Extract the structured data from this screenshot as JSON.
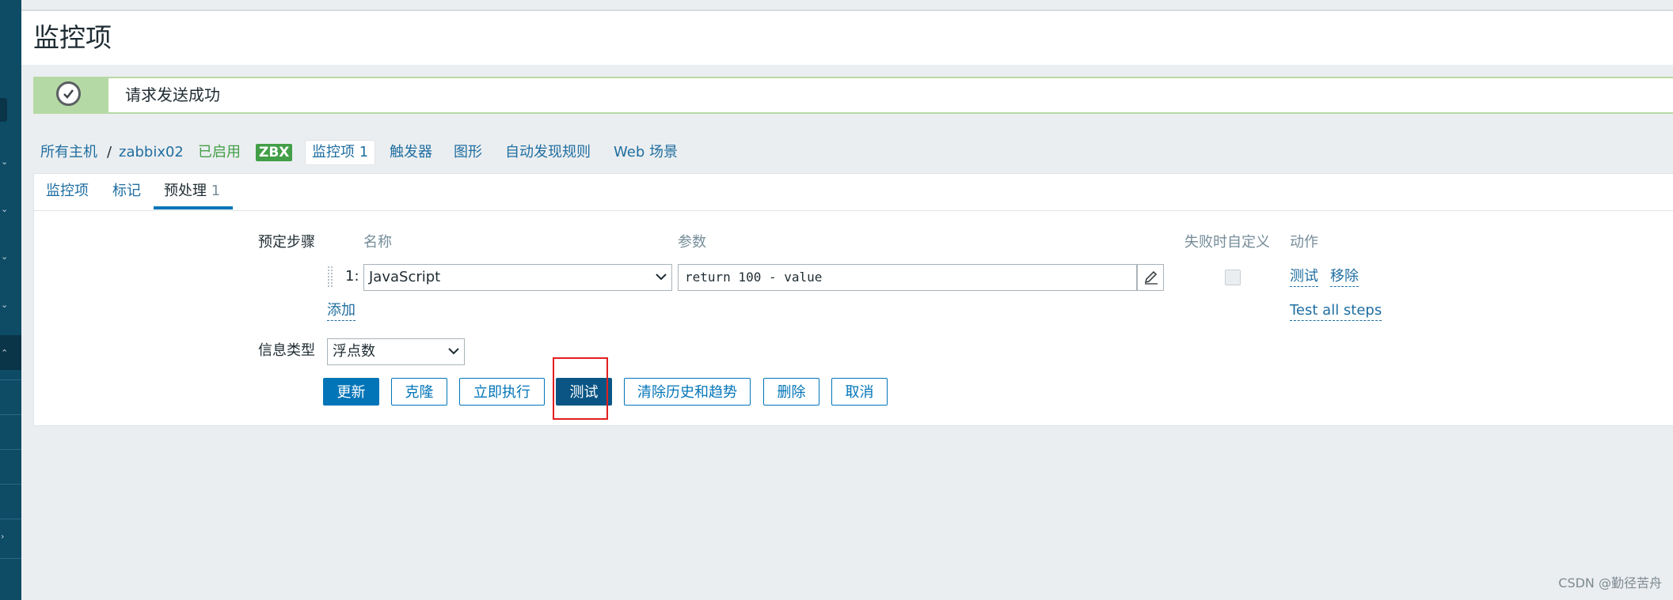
{
  "page": {
    "title": "监控项"
  },
  "message": {
    "text": "请求发送成功"
  },
  "nav": {
    "all_hosts": "所有主机",
    "separator": "/",
    "host": "zabbix02",
    "status": "已启用",
    "badge": "ZBX",
    "items_label": "监控项",
    "items_count": "1",
    "triggers": "触发器",
    "graphs": "图形",
    "discovery": "自动发现规则",
    "web": "Web 场景"
  },
  "tabs": [
    {
      "label": "监控项"
    },
    {
      "label": "标记"
    },
    {
      "label": "预处理",
      "count": "1"
    }
  ],
  "preprocessing": {
    "section_label": "预定步骤",
    "columns": {
      "name": "名称",
      "params": "参数",
      "custom_on_fail": "失败时自定义",
      "actions": "动作"
    },
    "steps": [
      {
        "index": "1:",
        "name": "JavaScript",
        "param": "return 100 - value",
        "custom_on_fail": false,
        "actions": {
          "test": "测试",
          "remove": "移除"
        }
      }
    ],
    "add_link": "添加",
    "test_all": "Test all steps"
  },
  "info_type": {
    "label": "信息类型",
    "value": "浮点数"
  },
  "buttons": {
    "update": "更新",
    "clone": "克隆",
    "execute_now": "立即执行",
    "test": "测试",
    "clear_history": "清除历史和趋势",
    "delete": "删除",
    "cancel": "取消"
  },
  "watermark": "CSDN @勤径苦舟",
  "colors": {
    "accent": "#0275b8",
    "success": "#429e47",
    "sidebar": "#0e4c66",
    "highlight": "#e41e1e"
  },
  "icons": {
    "sidebar_marks": [
      "chevron-down-icon",
      "chevron-down-icon",
      "chevron-down-icon",
      "chevron-down-icon",
      "chevron-up-icon",
      "chevron-right-icon"
    ]
  }
}
